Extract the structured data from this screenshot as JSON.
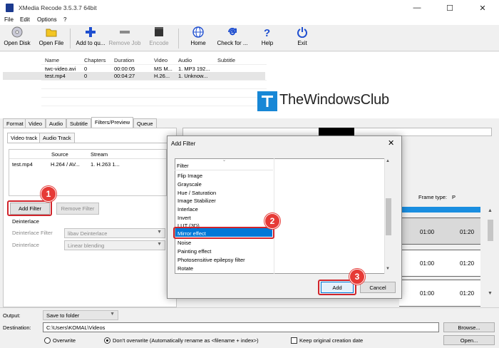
{
  "window": {
    "title": "XMedia Recode 3.5.3.7 64bit",
    "minimize": "—",
    "maximize": "☐",
    "close": "✕"
  },
  "menu": [
    "File",
    "Edit",
    "Options",
    "?"
  ],
  "toolbar": {
    "open_disk": "Open Disk",
    "open_file": "Open File",
    "add_to_queue": "Add to qu...",
    "remove_job": "Remove Job",
    "encode": "Encode",
    "home": "Home",
    "check_for_updates": "Check for ...",
    "help": "Help",
    "exit": "Exit"
  },
  "file_list": {
    "columns": [
      "Name",
      "Chapters",
      "Duration",
      "Video",
      "Audio",
      "Subtitle"
    ],
    "rows": [
      [
        "twc-video.avi",
        "0",
        "00:00:05",
        "MS M...",
        "1. MP3 192...",
        ""
      ],
      [
        "test.mp4",
        "0",
        "00:04:27",
        "H.26...",
        "1. Unknow...",
        ""
      ]
    ]
  },
  "watermark": "TheWindowsClub",
  "tabs": [
    "Format",
    "Video",
    "Audio",
    "Subtitle",
    "Filters/Preview",
    "Queue"
  ],
  "filters_panel": {
    "subtabs": [
      "Video track",
      "Audio Track"
    ],
    "track_columns": [
      "",
      "Source",
      "Stream"
    ],
    "track_row": [
      "test.mp4",
      "H.264 / AV...",
      "1. H.263 1..."
    ],
    "add_filter": "Add Filter",
    "remove_filter": "Remove Filter",
    "section": "Deinterlace",
    "deinterlace_filter_label": "Deinterlace Filter",
    "deinterlace_filter_value": "libav Deinterlace",
    "deinterlace_label": "Deinterlace",
    "deinterlace_value": "Linear blending"
  },
  "preview": {
    "frame_type_label": "Frame type:",
    "frame_type_value": "P",
    "times": [
      "01:00",
      "01:20"
    ]
  },
  "dialog": {
    "title": "Add Filter",
    "close": "✕",
    "column": "Filter",
    "items": [
      "Flip Image",
      "Grayscale",
      "Hue / Saturation",
      "Image Stabilizer",
      "Interlace",
      "Invert",
      "LUT (3D)",
      "Mirror effect",
      "Noise",
      "Painting effect",
      "Photosensitive epilepsy filter",
      "Rotate"
    ],
    "selected": "Mirror effect",
    "add": "Add",
    "cancel": "Cancel"
  },
  "badges": [
    "1",
    "2",
    "3"
  ],
  "bottom": {
    "output_label": "Output:",
    "output_value": "Save to folder",
    "destination_label": "Destination:",
    "destination_value": "C:\\Users\\KOMAL\\Videos",
    "browse": "Browse...",
    "open": "Open...",
    "overwrite": "Overwrite",
    "dont_overwrite": "Don't overwrite (Automatically rename as <filename + index>)",
    "keep_date": "Keep original creation date"
  },
  "colors": {
    "accent": "#0078d7",
    "highlight_red": "#d0242b",
    "badge": "#e63a36",
    "progress_blue": "#1a8ee0"
  }
}
